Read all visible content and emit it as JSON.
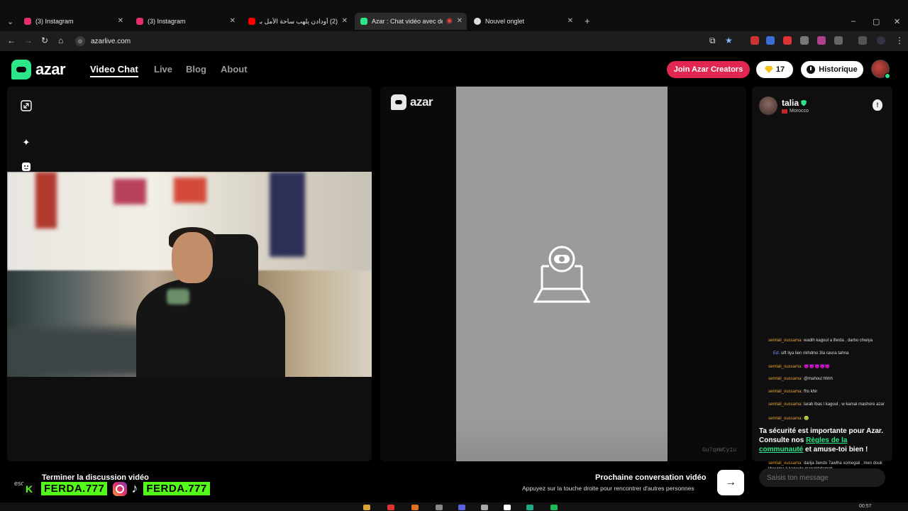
{
  "browser": {
    "tabs": [
      {
        "label": "(3) Instagram",
        "color": "#e1306c"
      },
      {
        "label": "(3) Instagram",
        "color": "#e1306c"
      },
      {
        "label": "(2) أودادن يلهب ساحة الأمل بمر...",
        "color": "#ff0000"
      },
      {
        "label": "Azar : Chat vidéo avec de n...",
        "color": "#2ee68a"
      },
      {
        "label": "Nouvel onglet",
        "color": "#dddddd"
      }
    ],
    "url": "azarlive.com"
  },
  "header": {
    "logo_text": "azar",
    "nav": [
      "Video Chat",
      "Live",
      "Blog",
      "About"
    ],
    "creators_label": "Join Azar Creators",
    "gems_count": "17",
    "history_label": "Historique"
  },
  "center": {
    "logo_text": "azar",
    "session_code": "Gu7qmWCy1u"
  },
  "partner": {
    "name": "talia",
    "country": "Morocco"
  },
  "chat": {
    "messages": [
      {
        "user": "semlali_oussama:",
        "text": "wadih kagoul a lferda , darbo chwiya",
        "kind": "u"
      },
      {
        "user": "‪‬:",
        "text": "sift liya lien nkhdmo 3la rasna tahna",
        "kind": "u2"
      },
      {
        "user": "semlali_oussama:",
        "text": "😈😈😈😈😈",
        "kind": "u"
      },
      {
        "user": "semlali_oussama:",
        "text": "@mahoul hhhh",
        "kind": "u"
      },
      {
        "user": "semlali_oussama:",
        "text": "fhs khir",
        "kind": "u"
      },
      {
        "user": "semlali_oussama:",
        "text": "larab lbas l kagoul , w kamal mashore azar",
        "kind": "u"
      },
      {
        "user": "semlali_oussama:",
        "text": "🤢",
        "kind": "u"
      },
      {
        "user": "semlali_oussama:",
        "text": "darija 3endo 7awlha somegali , men douk khouima li kagoulo manakhdamch",
        "kind": "u"
      }
    ],
    "safety_prefix": "Ta sécurité est importante pour Azar. Consulte nos",
    "safety_link": "Règles de la communauté",
    "safety_suffix": "et amuse-toi bien !",
    "input_placeholder": "Saisis ton message"
  },
  "bottom": {
    "esc_label": "esc",
    "end_title": "Terminer la discussion vidéo",
    "overlay_handle_1": "FERDA.777",
    "overlay_handle_2": "FERDA.777",
    "next_title": "Prochaine conversation vidéo",
    "next_sub": "Appuyez sur la touche droite pour rencontrer d'autres personnes"
  },
  "taskbar": {
    "time": "00:57"
  },
  "colors": {
    "accent": "#2ee68a",
    "creators": "#e1274f",
    "kick_green": "#53fc18"
  }
}
